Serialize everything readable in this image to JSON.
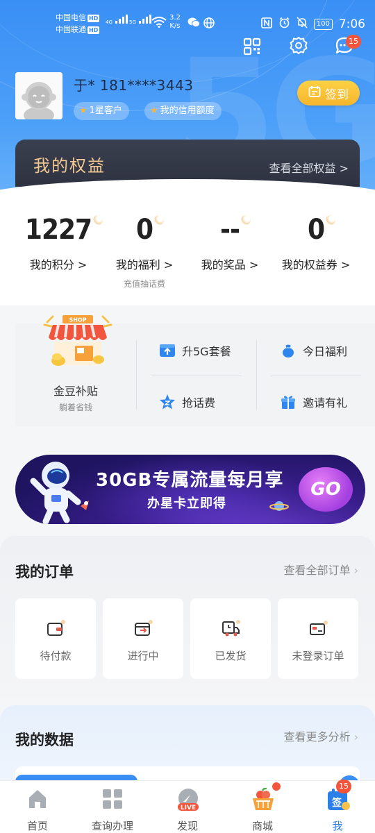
{
  "status_bar": {
    "carrier1": "中国电信",
    "carrier2": "中国联通",
    "hd": "HD",
    "net1": "4G",
    "net2": "5G",
    "speed_value": "3.2",
    "speed_unit": "K/s",
    "battery": "100",
    "time": "7:06"
  },
  "header": {
    "message_badge": "15",
    "user_name": "于* 181****3443",
    "tag_level": "1星客户",
    "tag_credit": "我的信用额度",
    "signin_label": "签到"
  },
  "rights": {
    "title": "我的权益",
    "view_all": "查看全部权益 >"
  },
  "stats": [
    {
      "value": "1227",
      "label": "我的积分 >",
      "sub": ""
    },
    {
      "value": "0",
      "label": "我的福利 >",
      "sub": "充值抽话费"
    },
    {
      "value": "--",
      "label": "我的奖品 >",
      "sub": ""
    },
    {
      "value": "0",
      "label": "我的权益券 >",
      "sub": ""
    }
  ],
  "services": {
    "main_title": "金豆补贴",
    "main_sub": "躺着省钱",
    "shop_sign": "SHOP",
    "items": [
      {
        "label": "升5G套餐",
        "icon": "upgrade-5g-icon"
      },
      {
        "label": "今日福利",
        "icon": "gift-bag-icon"
      },
      {
        "label": "抢话费",
        "icon": "star-icon"
      },
      {
        "label": "邀请有礼",
        "icon": "gift-box-icon"
      }
    ]
  },
  "banner": {
    "line1": "30GB专属流量每月享",
    "line2": "办星卡立即得",
    "go": "GO"
  },
  "orders": {
    "title": "我的订单",
    "view_all": "查看全部订单",
    "items": [
      {
        "label": "待付款",
        "icon": "wallet-icon"
      },
      {
        "label": "进行中",
        "icon": "in-progress-icon"
      },
      {
        "label": "已发货",
        "icon": "delivery-truck-icon"
      },
      {
        "label": "未登录订单",
        "icon": "card-icon"
      }
    ]
  },
  "mydata": {
    "title": "我的数据",
    "view_more": "查看更多分析"
  },
  "bottom_nav": {
    "items": [
      {
        "label": "首页",
        "icon": "home-icon"
      },
      {
        "label": "查询办理",
        "icon": "grid-icon"
      },
      {
        "label": "发现",
        "icon": "live-icon"
      },
      {
        "label": "商城",
        "icon": "basket-icon"
      },
      {
        "label": "我",
        "icon": "me-sign-icon"
      }
    ],
    "live_tag": "LIVE",
    "me_badge": "15",
    "me_icon_text": "签"
  },
  "colors": {
    "primary_blue": "#3a8ff5",
    "gold": "#f7b52d",
    "badge_red": "#f3553c"
  }
}
